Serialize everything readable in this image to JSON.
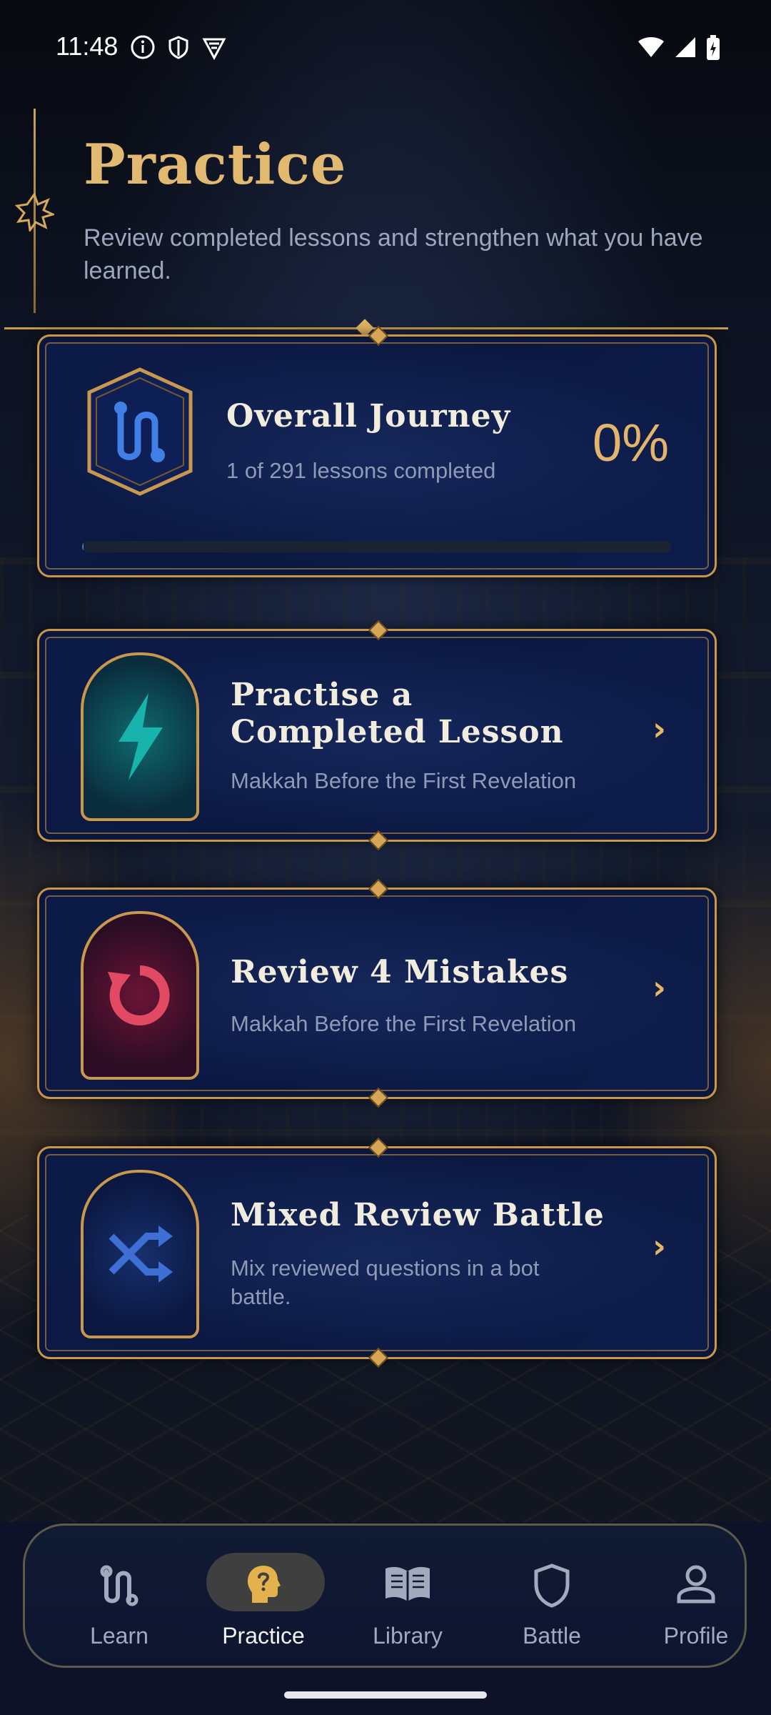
{
  "status_bar": {
    "time": "11:48"
  },
  "header": {
    "title": "Practice",
    "subtitle": "Review completed lessons and strengthen what you have learned."
  },
  "journey": {
    "title": "Overall Journey",
    "subtitle": "1 of 291 lessons completed",
    "percent_label": "0%",
    "progress_fraction": 0.003
  },
  "cards": [
    {
      "title": "Practise a Completed Lesson",
      "subtitle": "Makkah Before the First Revelation",
      "icon": "lightning-icon",
      "accent": "#19a3a0"
    },
    {
      "title": "Review 4 Mistakes",
      "subtitle": "Makkah Before the First Revelation",
      "icon": "refresh-icon",
      "accent": "#d8455f"
    },
    {
      "title": "Mixed Review Battle",
      "subtitle": "Mix reviewed questions in a bot battle.",
      "icon": "shuffle-icon",
      "accent": "#3d6fd4"
    }
  ],
  "nav": {
    "items": [
      {
        "label": "Learn",
        "icon": "path-icon",
        "active": false
      },
      {
        "label": "Practice",
        "icon": "question-head-icon",
        "active": true
      },
      {
        "label": "Library",
        "icon": "book-icon",
        "active": false
      },
      {
        "label": "Battle",
        "icon": "shield-icon",
        "active": false
      },
      {
        "label": "Profile",
        "icon": "person-icon",
        "active": false
      }
    ]
  },
  "colors": {
    "gold": "#e2b971",
    "navy": "#0b1844",
    "nav_active_pill": "#3f3f3f"
  }
}
